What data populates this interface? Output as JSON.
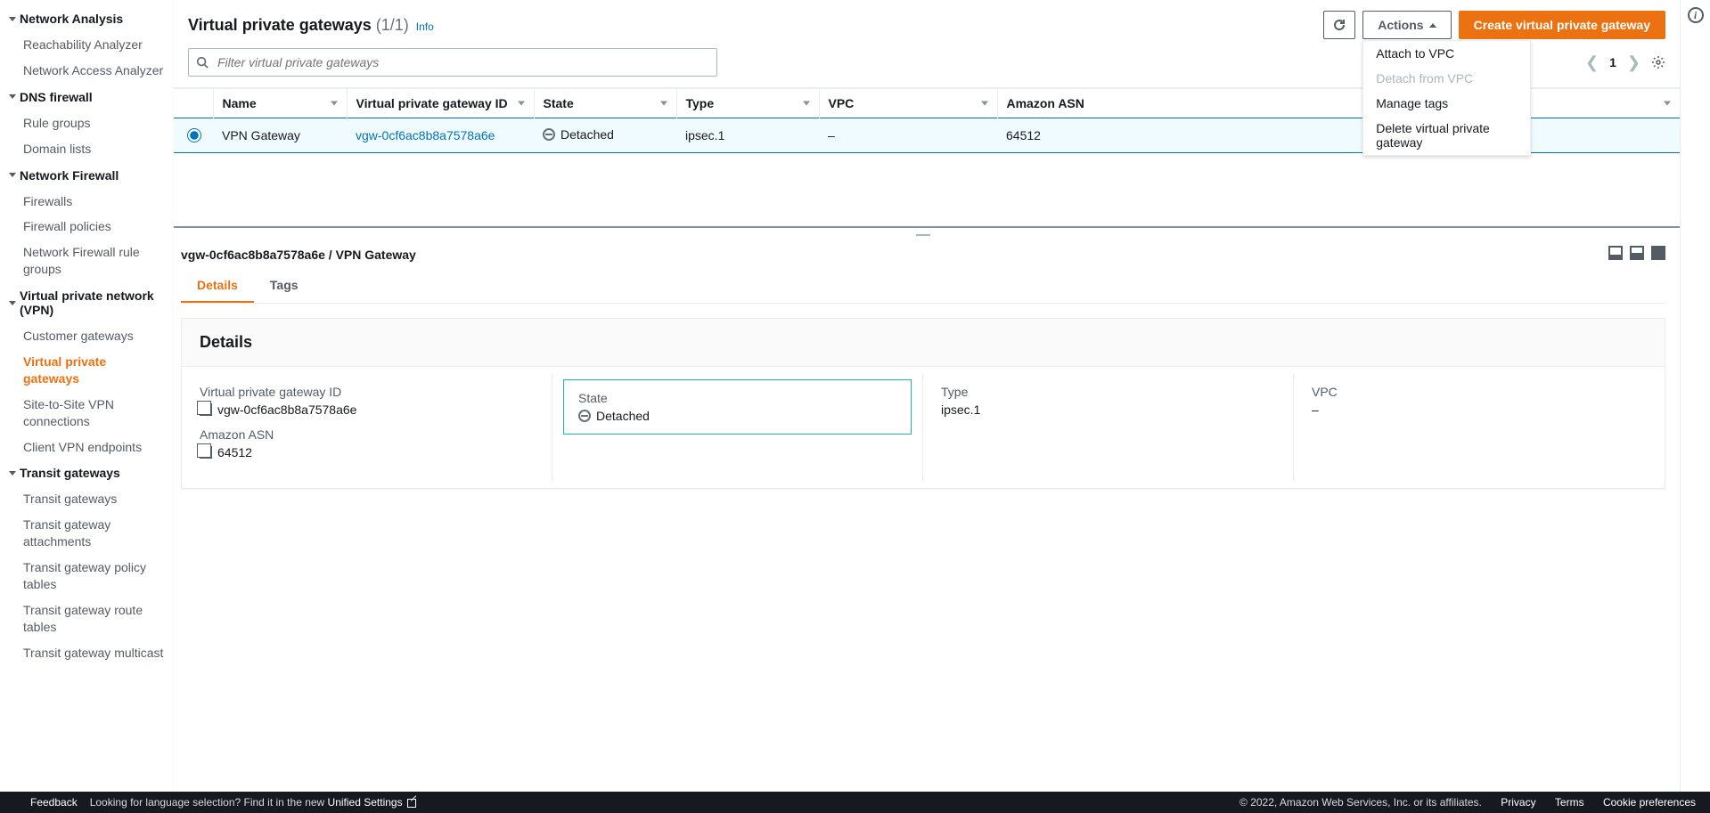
{
  "sidebar": {
    "sections": [
      {
        "label": "Network Analysis",
        "items": [
          "Reachability Analyzer",
          "Network Access Analyzer"
        ]
      },
      {
        "label": "DNS firewall",
        "items": [
          "Rule groups",
          "Domain lists"
        ]
      },
      {
        "label": "Network Firewall",
        "items": [
          "Firewalls",
          "Firewall policies",
          "Network Firewall rule groups"
        ]
      },
      {
        "label": "Virtual private network (VPN)",
        "items": [
          "Customer gateways",
          "Virtual private gateways",
          "Site-to-Site VPN connections",
          "Client VPN endpoints"
        ],
        "activeIndex": 1
      },
      {
        "label": "Transit gateways",
        "items": [
          "Transit gateways",
          "Transit gateway attachments",
          "Transit gateway policy tables",
          "Transit gateway route tables",
          "Transit gateway multicast"
        ]
      }
    ]
  },
  "header": {
    "title": "Virtual private gateways",
    "count": "(1/1)",
    "info": "Info",
    "actions": "Actions",
    "create": "Create virtual private gateway"
  },
  "actionsMenu": {
    "attach": "Attach to VPC",
    "detach": "Detach from VPC",
    "manage": "Manage tags",
    "delete": "Delete virtual private gateway"
  },
  "filter": {
    "placeholder": "Filter virtual private gateways"
  },
  "pagination": {
    "page": "1"
  },
  "table": {
    "cols": {
      "name": "Name",
      "vgwid": "Virtual private gateway ID",
      "state": "State",
      "type": "Type",
      "vpc": "VPC",
      "asn": "Amazon ASN"
    },
    "row": {
      "name": "VPN Gateway",
      "vgwid": "vgw-0cf6ac8b8a7578a6e",
      "state": "Detached",
      "type": "ipsec.1",
      "vpc": "–",
      "asn": "64512"
    }
  },
  "detail": {
    "title": "vgw-0cf6ac8b8a7578a6e / VPN Gateway",
    "tabs": {
      "details": "Details",
      "tags": "Tags"
    },
    "card_title": "Details",
    "fields": {
      "vgwid_label": "Virtual private gateway ID",
      "vgwid_value": "vgw-0cf6ac8b8a7578a6e",
      "asn_label": "Amazon ASN",
      "asn_value": "64512",
      "state_label": "State",
      "state_value": "Detached",
      "type_label": "Type",
      "type_value": "ipsec.1",
      "vpc_label": "VPC",
      "vpc_value": "–"
    }
  },
  "footer": {
    "feedback": "Feedback",
    "lang_prompt": "Looking for language selection? Find it in the new ",
    "unified": "Unified Settings",
    "copyright": "© 2022, Amazon Web Services, Inc. or its affiliates.",
    "privacy": "Privacy",
    "terms": "Terms",
    "cookie": "Cookie preferences"
  }
}
